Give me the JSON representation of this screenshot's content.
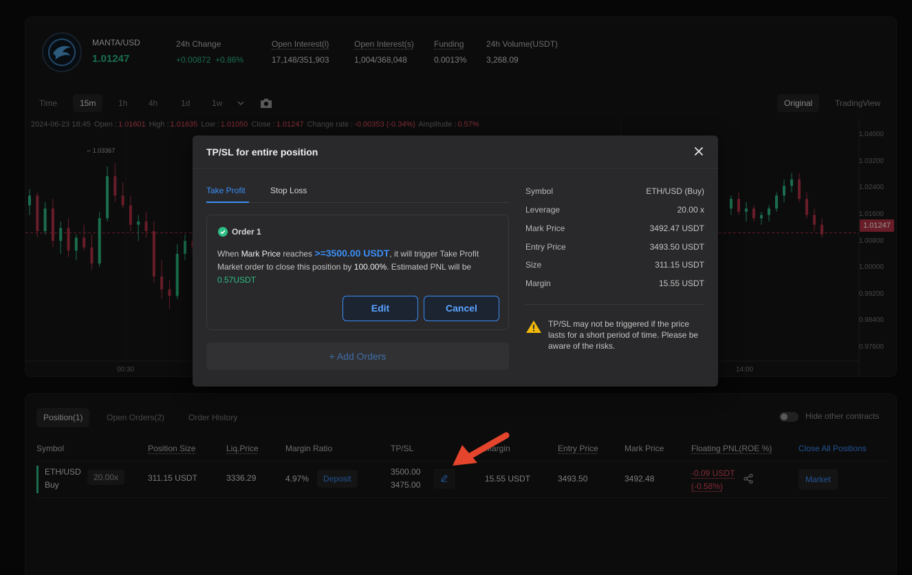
{
  "ticker": {
    "pair": "MANTA/USD",
    "price": "1.01247",
    "stats": [
      {
        "label": "24h Change",
        "value_a": "+0.00872",
        "value_b": "+0.86%"
      },
      {
        "label": "Open Interest(l)",
        "value": "17,148/351,903"
      },
      {
        "label": "Open Interest(s)",
        "value": "1,004/368,048"
      },
      {
        "label": "Funding",
        "value": "0.0013%"
      },
      {
        "label": "24h Volume(USDT)",
        "value": "3,268.09"
      }
    ]
  },
  "chart_toolbar": {
    "timeframes": [
      "Time",
      "15m",
      "1h",
      "4h",
      "1d",
      "1w"
    ],
    "active": "15m",
    "views": [
      "Original",
      "TradingView"
    ]
  },
  "ohlc": {
    "date": "2024-06-23 18:45",
    "open_label": "Open :",
    "open": "1.01601",
    "high_label": "High :",
    "high": "1.01635",
    "low_label": "Low :",
    "low": "1.01050",
    "close_label": "Close :",
    "close": "1.01247",
    "change_label": "Change rate :",
    "change": "-0.00353 (-0.34%)",
    "amp_label": "Amplitude :",
    "amp": "0.57%"
  },
  "chart": {
    "y_ticks": [
      "1.04000",
      "1.03200",
      "1.02400",
      "1.01600",
      "1.00800",
      "1.00000",
      "0.99200",
      "0.98400",
      "0.97600"
    ],
    "price_tag": "1.01247",
    "high_marker": "1.03367",
    "x_ticks": [
      "00:30",
      "14:00"
    ]
  },
  "chart_data": {
    "type": "candlestick",
    "ylim": [
      0.972,
      1.043
    ],
    "current_price": 1.01247,
    "high_marker": 1.03367,
    "x_ticks": [
      "00:30",
      "14:00"
    ],
    "left_segment": [
      [
        1.021,
        1.026,
        1.018,
        1.024
      ],
      [
        1.024,
        1.025,
        1.011,
        1.013
      ],
      [
        1.013,
        1.022,
        1.012,
        1.02
      ],
      [
        1.02,
        1.023,
        1.008,
        1.01
      ],
      [
        1.01,
        1.016,
        1.006,
        1.014
      ],
      [
        1.014,
        1.017,
        1.005,
        1.007
      ],
      [
        1.007,
        1.012,
        1.004,
        1.011
      ],
      [
        1.011,
        1.015,
        1.007,
        1.008
      ],
      [
        1.008,
        1.012,
        1.001,
        1.003
      ],
      [
        1.003,
        1.019,
        1.002,
        1.017
      ],
      [
        1.017,
        1.033,
        1.016,
        1.03
      ],
      [
        1.03,
        1.034,
        1.022,
        1.024
      ],
      [
        1.024,
        1.028,
        1.02,
        1.021
      ],
      [
        1.021,
        1.024,
        1.013,
        1.015
      ],
      [
        1.015,
        1.018,
        1.01,
        1.016
      ],
      [
        1.016,
        1.019,
        1.011,
        1.013
      ],
      [
        1.013,
        1.016,
        0.997,
        0.999
      ],
      [
        0.999,
        1.004,
        0.992,
        0.995
      ],
      [
        0.995,
        0.998,
        0.989,
        0.993
      ],
      [
        0.993,
        1.009,
        0.992,
        1.006
      ],
      [
        1.006,
        1.012,
        1.004,
        1.01
      ],
      [
        1.01,
        1.013,
        1.005,
        1.008
      ]
    ],
    "right_segment": [
      [
        1.02,
        1.024,
        1.018,
        1.023
      ],
      [
        1.023,
        1.025,
        1.018,
        1.019
      ],
      [
        1.019,
        1.022,
        1.016,
        1.02
      ],
      [
        1.02,
        1.021,
        1.016,
        1.017
      ],
      [
        1.017,
        1.019,
        1.015,
        1.018
      ],
      [
        1.018,
        1.021,
        1.016,
        1.02
      ],
      [
        1.02,
        1.025,
        1.019,
        1.024
      ],
      [
        1.024,
        1.029,
        1.022,
        1.027
      ],
      [
        1.027,
        1.031,
        1.025,
        1.029
      ],
      [
        1.029,
        1.031,
        1.022,
        1.023
      ],
      [
        1.023,
        1.025,
        1.017,
        1.018
      ],
      [
        1.018,
        1.02,
        1.013,
        1.015
      ],
      [
        1.015,
        1.017,
        1.011,
        1.012
      ]
    ]
  },
  "modal": {
    "title": "TP/SL for entire position",
    "tabs": [
      "Take Profit",
      "Stop Loss"
    ],
    "order_title": "Order 1",
    "desc": {
      "p1": "When ",
      "mark": "Mark Price",
      "p2": " reaches ",
      "target": ">=3500.00 USDT",
      "p3": ", it will trigger Take Profit Market order to close this position by ",
      "pct": "100.00%",
      "p4": ". Estimated PNL will be ",
      "pnl": "0.57USDT"
    },
    "edit_label": "Edit",
    "cancel_label": "Cancel",
    "add_orders_label": "+  Add Orders",
    "details": [
      {
        "label": "Symbol",
        "value": "ETH/USD (Buy)"
      },
      {
        "label": "Leverage",
        "value": "20.00 x"
      },
      {
        "label": "Mark Price",
        "value": "3492.47 USDT"
      },
      {
        "label": "Entry Price",
        "value": "3493.50 USDT"
      },
      {
        "label": "Size",
        "value": "311.15 USDT"
      },
      {
        "label": "Margin",
        "value": "15.55 USDT"
      }
    ],
    "warning": "TP/SL may not be triggered if the price lasts for a short period of time. Please be aware of the risks.",
    "accent": "#3a8ef6"
  },
  "positions": {
    "tabs": [
      "Position(1)",
      "Open Orders(2)",
      "Order History"
    ],
    "hide_label": "Hide other contracts",
    "headers": [
      "Symbol",
      "Position Size",
      "Liq.Price",
      "Margin Ratio",
      "TP/SL",
      "Margin",
      "Entry Price",
      "Mark Price",
      "Floating PNL(ROE %)"
    ],
    "close_all": "Close All Positions",
    "row": {
      "symbol": "ETH/USD",
      "side": "Buy",
      "leverage": "20.00x",
      "size": "311.15 USDT",
      "liq": "3336.29",
      "margin_ratio": "4.97%",
      "deposit": "Deposit",
      "tp": "3500.00",
      "sl": "3475.00",
      "margin": "15.55 USDT",
      "entry": "3493.50",
      "mark": "3492.48",
      "pnl": "-0.09 USDT",
      "roe": "(-0.58%)",
      "market": "Market"
    }
  }
}
